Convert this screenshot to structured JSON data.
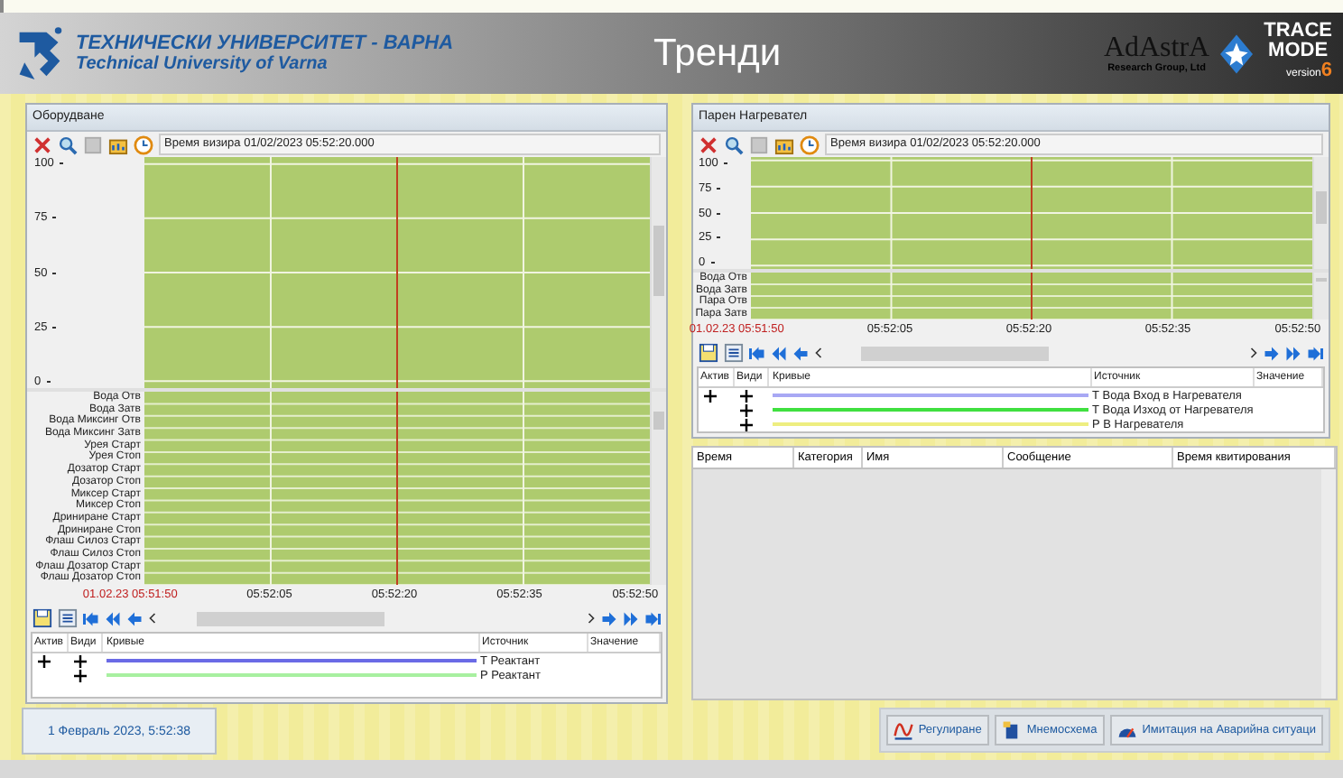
{
  "header": {
    "university_bg": "ТЕХНИЧЕСКИ УНИВЕРСИТЕТ - ВАРНА",
    "university_en": "Technical University of Varna",
    "title": "Тренди",
    "adastra": "AdAstrA",
    "adastra_sub": "Research Group, Ltd",
    "trace": "TRACE",
    "mode": "MODE",
    "version": "version",
    "version_number": "6"
  },
  "trend_panels": [
    {
      "title": "Оборудване",
      "cursor_time": "Время визира 01/02/2023 05:52:20.000",
      "yticks": [
        "100",
        "75",
        "50",
        "25",
        "0"
      ],
      "discrete_signals": [
        "Вода Отв",
        "Вода Затв",
        "Вода Миксинг Отв",
        "Вода Миксинг Затв",
        "Урея Старт",
        "Урея Стоп",
        "Дозатор Старт",
        "Дозатор Стоп",
        "Миксер Старт",
        "Миксер Стоп",
        "Дриниране Старт",
        "Дриниране Стоп",
        "Флаш Силоз Старт",
        "Флаш Силоз Стоп",
        "Флаш Дозатор Старт",
        "Флаш Дозатор Стоп"
      ],
      "time_labels": [
        "01.02.23 05:51:50",
        "05:52:05",
        "05:52:20",
        "05:52:35",
        "05:52:50"
      ],
      "legend_columns": [
        "Актив",
        "Види",
        "Кривые",
        "Источник",
        "Значение"
      ],
      "curves": [
        {
          "active": true,
          "visible": true,
          "color": "#6a6ae6",
          "source": "Т Реактант"
        },
        {
          "active": false,
          "visible": true,
          "color": "#a8f0a0",
          "source": "Р Реактант"
        }
      ]
    },
    {
      "title": "Парен Нагревател",
      "cursor_time": "Время визира 01/02/2023 05:52:20.000",
      "yticks": [
        "100",
        "75",
        "50",
        "25",
        "0"
      ],
      "discrete_signals": [
        "Вода Отв",
        "Вода Затв",
        "Пара Отв",
        "Пара Затв"
      ],
      "time_labels": [
        "01.02.23 05:51:50",
        "05:52:05",
        "05:52:20",
        "05:52:35",
        "05:52:50"
      ],
      "legend_columns": [
        "Актив",
        "Види",
        "Кривые",
        "Источник",
        "Значение"
      ],
      "curves": [
        {
          "active": true,
          "visible": true,
          "color": "#a8a8f4",
          "source": "Т Вода Вход в Нагревателя"
        },
        {
          "active": false,
          "visible": true,
          "color": "#40e040",
          "source": "Т Вода Изход от Нагревателя"
        },
        {
          "active": false,
          "visible": true,
          "color": "#eeee80",
          "source": "Р В Нагревателя"
        }
      ]
    }
  ],
  "alarm_table": {
    "columns": [
      "Время",
      "Категория",
      "Имя",
      "Сообщение",
      "Время квитирования"
    ]
  },
  "status_date": "1 Февраль 2023, 5:52:38",
  "nav_buttons": [
    {
      "kind": "regulation",
      "label": "Регулиране"
    },
    {
      "kind": "mimic",
      "label": "Мнемосхема"
    },
    {
      "kind": "alarm",
      "label": "Имитация на Аварийна ситуаци"
    }
  ]
}
